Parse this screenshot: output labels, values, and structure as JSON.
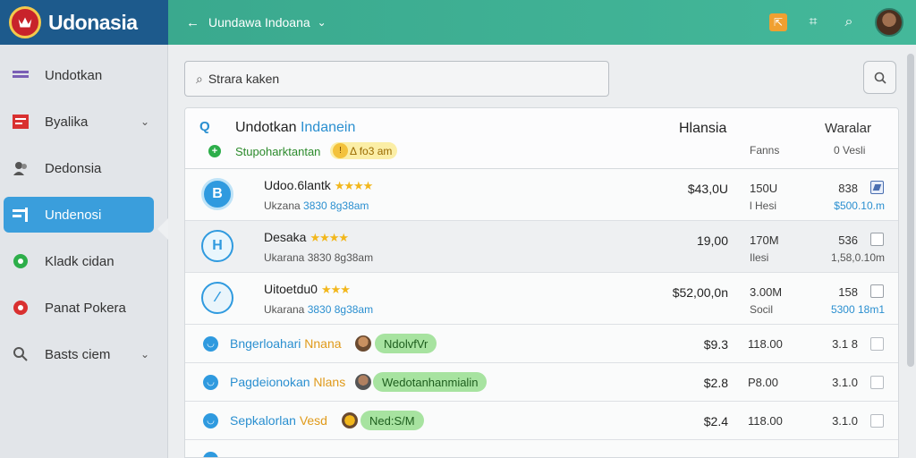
{
  "brand": {
    "name": "Udonasia"
  },
  "topnav": {
    "back": "←",
    "crumb": "Uundawa Indoana",
    "chevron": "⌄"
  },
  "sidebar": {
    "items": [
      {
        "label": "Undotkan",
        "icon": "menu-icon"
      },
      {
        "label": "Byalika",
        "icon": "chart-icon",
        "arrow": "⌄"
      },
      {
        "label": "Dedonsia",
        "icon": "users-icon"
      },
      {
        "label": "Undenosi",
        "icon": "tag-icon"
      },
      {
        "label": "Kladk cidan",
        "icon": "circle-green-icon"
      },
      {
        "label": "Panat Pokera",
        "icon": "circle-red-icon"
      },
      {
        "label": "Basts ciem",
        "icon": "search-icon",
        "arrow": "⌄"
      }
    ]
  },
  "search": {
    "placeholder": "Strara kaken"
  },
  "header": {
    "title_a": "Undotkan",
    "title_b": "Indanein",
    "sub": "Stupoharktantan",
    "chip": "Δ fo3 am",
    "col_price": "Hlansia",
    "col_right": "Waralar",
    "sub_col3": "Fanns",
    "sub_col4": "0 Vesli"
  },
  "rows": [
    {
      "icon_letter": "B",
      "name": "Udoo.6lantk",
      "sub_a": "Ukzana",
      "sub_b": "3830 8g38am",
      "price": "$43,0U",
      "c3": "150U",
      "c3b": "l Hesi",
      "c4": "838",
      "c4b": "$500.10.m",
      "checked": true
    },
    {
      "icon_letter": "H",
      "name": "Desaka",
      "sub_a": "Ukarana",
      "sub_b": "3830 8g38am",
      "price": "19,00",
      "c3": "170M",
      "c3b": "Ilesi",
      "c4": "536",
      "c4b": "1,58,0.10m",
      "checked": false
    },
    {
      "icon_letter": "∕",
      "name": "Uitoetdu0",
      "sub_a": "Ukarana",
      "sub_b": "3830 8g38am",
      "price": "$52,00,0n",
      "c3": "3.00M",
      "c3b": "Socil",
      "c4": "158",
      "c4b": "5300 18m1",
      "checked": false
    }
  ],
  "small_rows": [
    {
      "name_a": "Bngerloahari",
      "name_b": "Nnana",
      "tag": "NdolvfVr",
      "price": "$9.3",
      "c3": "118.00",
      "c4": "3.1 8"
    },
    {
      "name_a": "Pagdeionokan",
      "name_b": "Nlans",
      "tag": "Wedotanhanmialin",
      "price": "$2.8",
      "c3": "P8.00",
      "c4": "3.1.0"
    },
    {
      "name_a": "Sepkalorlan",
      "name_b": "Vesd",
      "tag": "Ned:S/M",
      "price": "$2.4",
      "c3": "118.00",
      "c4": "3.1.0"
    }
  ],
  "colors": {
    "brand_bg": "#1d5a8c",
    "topnav": "#3aa98e",
    "accent": "#3a9edc",
    "star": "#f2b71c",
    "tag_bg": "#a7e3a0"
  }
}
